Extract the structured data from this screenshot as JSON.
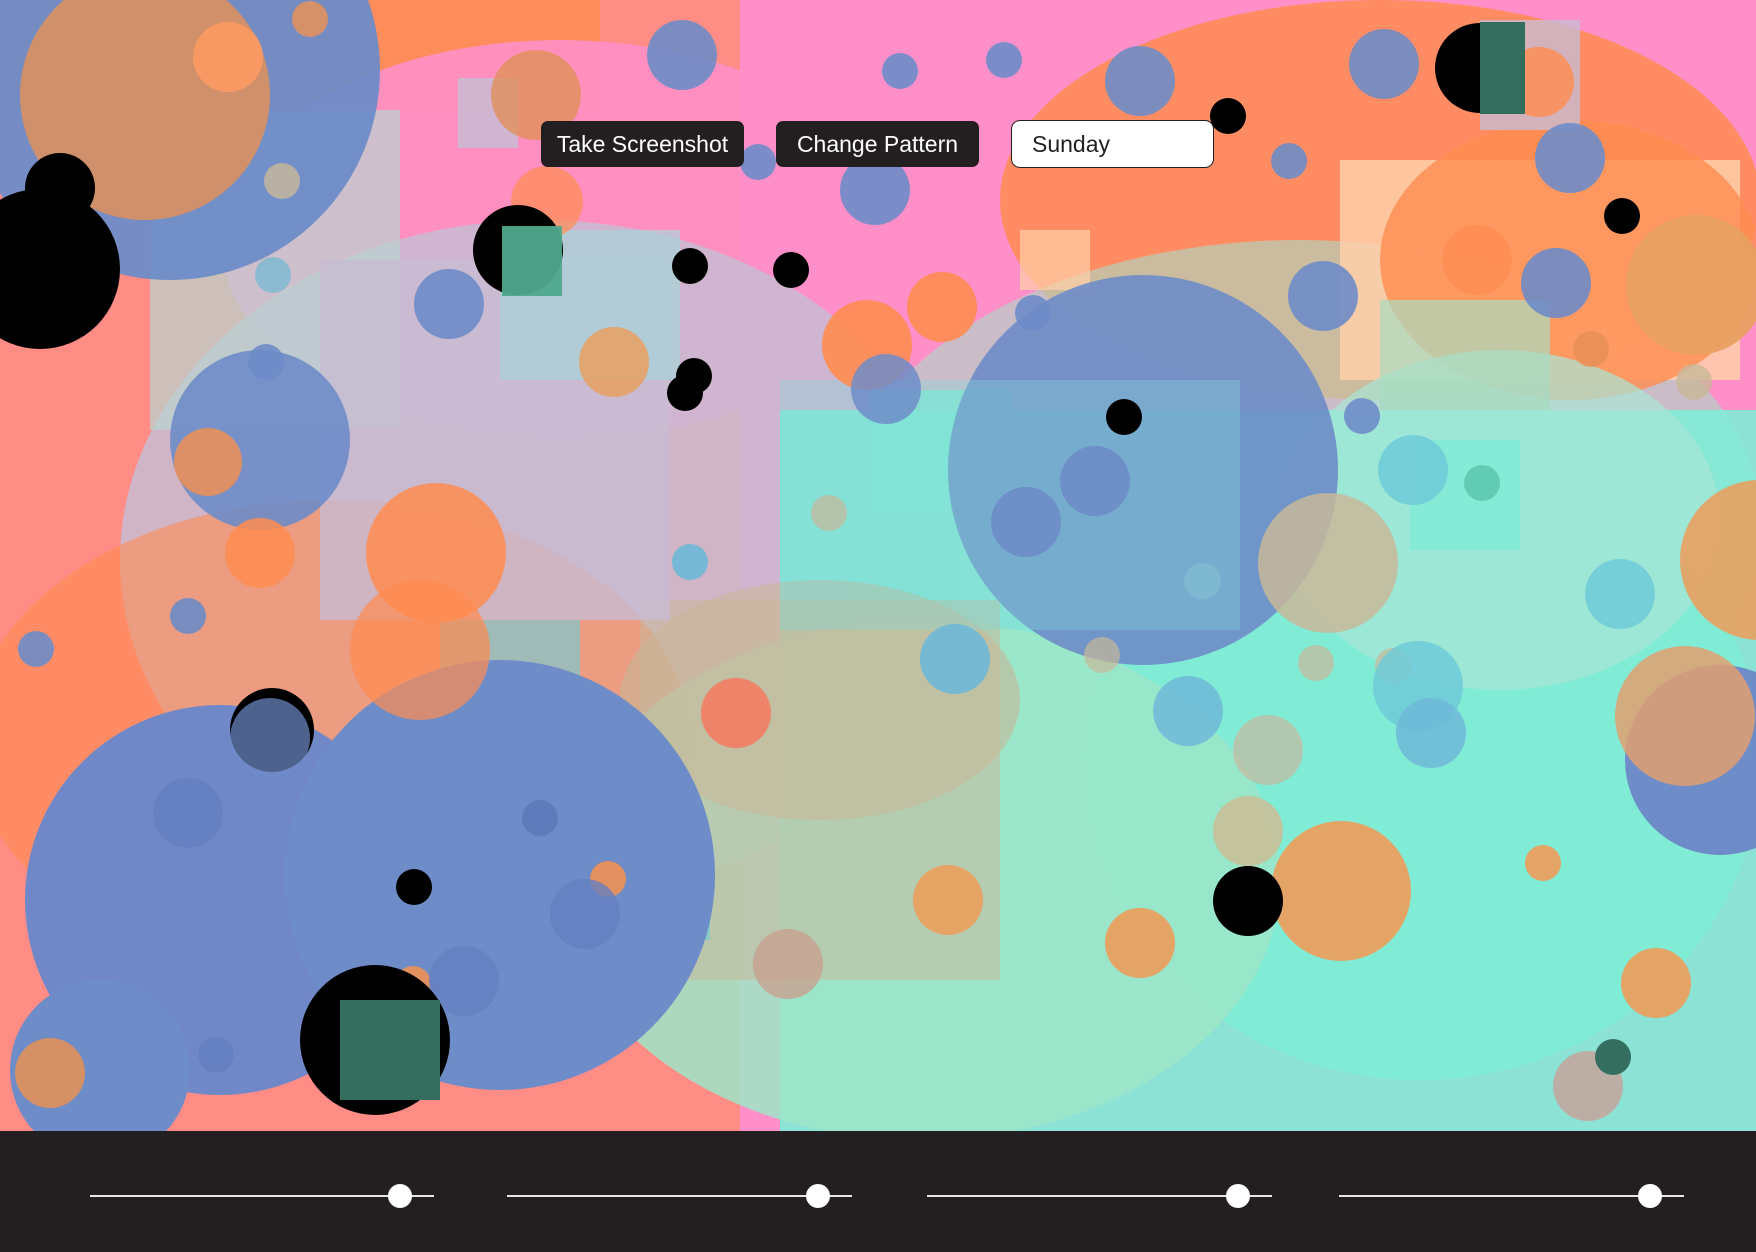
{
  "toolbar": {
    "screenshot_label": "Take Screenshot",
    "pattern_label": "Change Pattern",
    "day_value": "Sunday"
  },
  "colors": {
    "button_bg": "#231f20",
    "panel_bg": "#231f20",
    "pink": "#ff8fc8",
    "orange": "#ff8c50",
    "blue": "#6e8cc8",
    "teal": "#80ecd6",
    "peach": "#ffcfaa",
    "lavender": "#c8bcd2",
    "black": "#000000"
  },
  "sliders": [
    {
      "name": "slider-1",
      "value": 0.9
    },
    {
      "name": "slider-2",
      "value": 0.9
    },
    {
      "name": "slider-3",
      "value": 0.9
    },
    {
      "name": "slider-4",
      "value": 0.9
    }
  ]
}
